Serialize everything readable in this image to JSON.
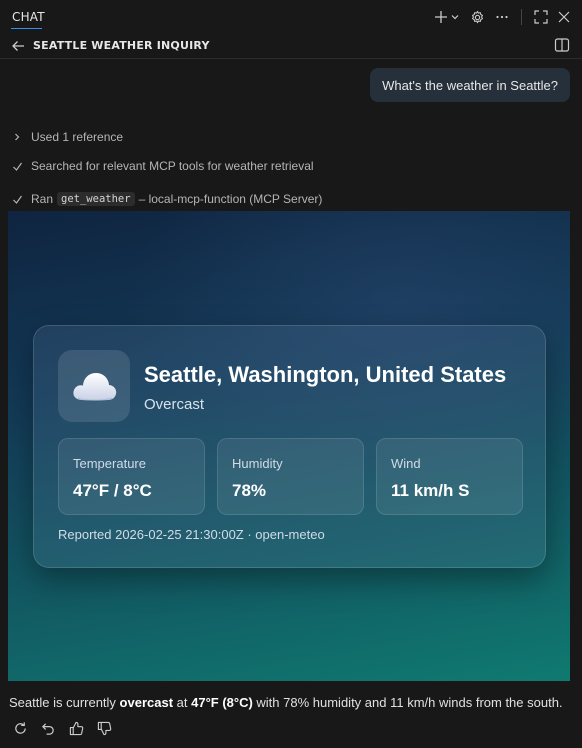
{
  "titlebar": {
    "tab_label": "CHAT"
  },
  "header": {
    "title": "SEATTLE WEATHER INQUIRY"
  },
  "conversation": {
    "user_message": "What's the weather in Seattle?",
    "steps": {
      "references": "Used 1 reference",
      "search": "Searched for relevant MCP tools for weather retrieval",
      "ran_prefix": "Ran",
      "tool_name": "get_weather",
      "tool_suffix": "– local-mcp-function (MCP Server)"
    }
  },
  "weather_card": {
    "location": "Seattle, Washington, United States",
    "condition": "Overcast",
    "metrics": [
      {
        "label": "Temperature",
        "value": "47°F / 8°C"
      },
      {
        "label": "Humidity",
        "value": "78%"
      },
      {
        "label": "Wind",
        "value": "11 km/h S"
      }
    ],
    "reported": "Reported 2026-02-25 21:30:00Z · open-meteo"
  },
  "answer": {
    "part1": "Seattle is currently ",
    "bold1": "overcast",
    "part2": " at ",
    "bold2": "47°F (8°C)",
    "part3": " with 78% humidity and 11 km/h winds from the south."
  },
  "colors": {
    "accent": "#3b8eea",
    "background": "#181818"
  }
}
